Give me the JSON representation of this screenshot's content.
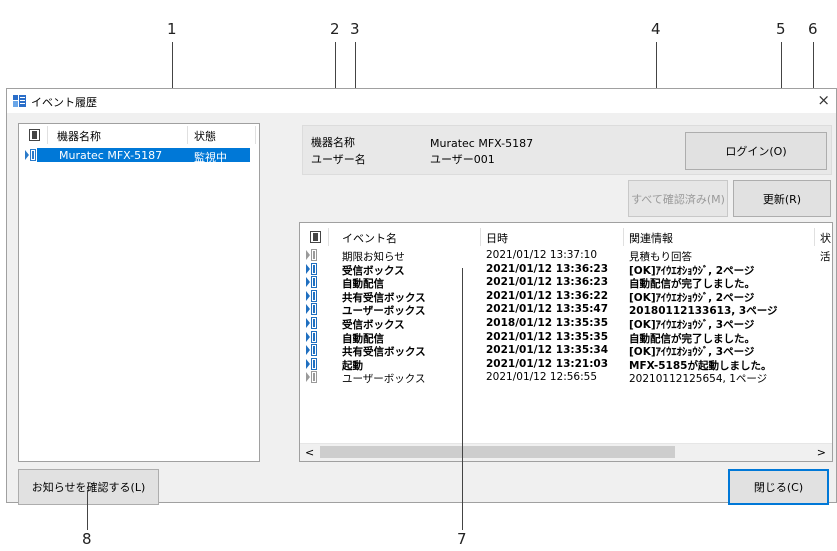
{
  "callouts": [
    "1",
    "2",
    "3",
    "4",
    "5",
    "6",
    "7",
    "8"
  ],
  "window": {
    "title": "イベント履歴",
    "close_glyph": "×"
  },
  "device_list": {
    "headers": {
      "name": "機器名称",
      "status": "状態"
    },
    "rows": [
      {
        "name": "Muratec MFX-5187",
        "status": "監視中",
        "selected": true
      }
    ]
  },
  "info": {
    "device_label": "機器名称",
    "device_value": "Muratec MFX-5187",
    "user_label": "ユーザー名",
    "user_value": "ユーザー001"
  },
  "buttons": {
    "login": "ログイン(O)",
    "confirm_all": "すべて確認済み(M)",
    "refresh": "更新(R)",
    "check_notice": "お知らせを確認する(L)",
    "close": "閉じる(C)"
  },
  "events": {
    "headers": {
      "event": "イベント名",
      "datetime": "日時",
      "related": "関連情報",
      "status": "状"
    },
    "rows": [
      {
        "unread": false,
        "event": "期限お知らせ",
        "datetime": "2021/01/12 13:37:10",
        "related": "見積もり回答",
        "status": "活"
      },
      {
        "unread": true,
        "event": "受信ボックス",
        "datetime": "2021/01/12 13:36:23",
        "related": "[OK]ｱｲｳｴｵｼｮｳｼﾞ, 2ページ",
        "status": ""
      },
      {
        "unread": true,
        "event": "自動配信",
        "datetime": "2021/01/12 13:36:23",
        "related": "自動配信が完了しました。",
        "status": ""
      },
      {
        "unread": true,
        "event": "共有受信ボックス",
        "datetime": "2021/01/12 13:36:22",
        "related": "[OK]ｱｲｳｴｵｼｮｳｼﾞ, 2ページ",
        "status": ""
      },
      {
        "unread": true,
        "event": "ユーザーボックス",
        "datetime": "2021/01/12 13:35:47",
        "related": "20180112133613, 3ページ",
        "status": ""
      },
      {
        "unread": true,
        "event": "受信ボックス",
        "datetime": "2018/01/12 13:35:35",
        "related": "[OK]ｱｲｳｴｵｼｮｳｼﾞ, 3ページ",
        "status": ""
      },
      {
        "unread": true,
        "event": "自動配信",
        "datetime": "2021/01/12 13:35:35",
        "related": "自動配信が完了しました。",
        "status": ""
      },
      {
        "unread": true,
        "event": "共有受信ボックス",
        "datetime": "2021/01/12 13:35:34",
        "related": "[OK]ｱｲｳｴｵｼｮｳｼﾞ, 3ページ",
        "status": ""
      },
      {
        "unread": true,
        "event": "起動",
        "datetime": "2021/01/12 13:21:03",
        "related": "MFX-5185が起動しました。",
        "status": ""
      },
      {
        "unread": false,
        "event": "ユーザーボックス",
        "datetime": "2021/01/12 12:56:55",
        "related": "20210112125654, 1ページ",
        "status": ""
      }
    ]
  },
  "scrollbar": {
    "left_glyph": "<",
    "right_glyph": ">"
  },
  "colors": {
    "selection": "#0078d7",
    "focus_border": "#0078d7"
  }
}
